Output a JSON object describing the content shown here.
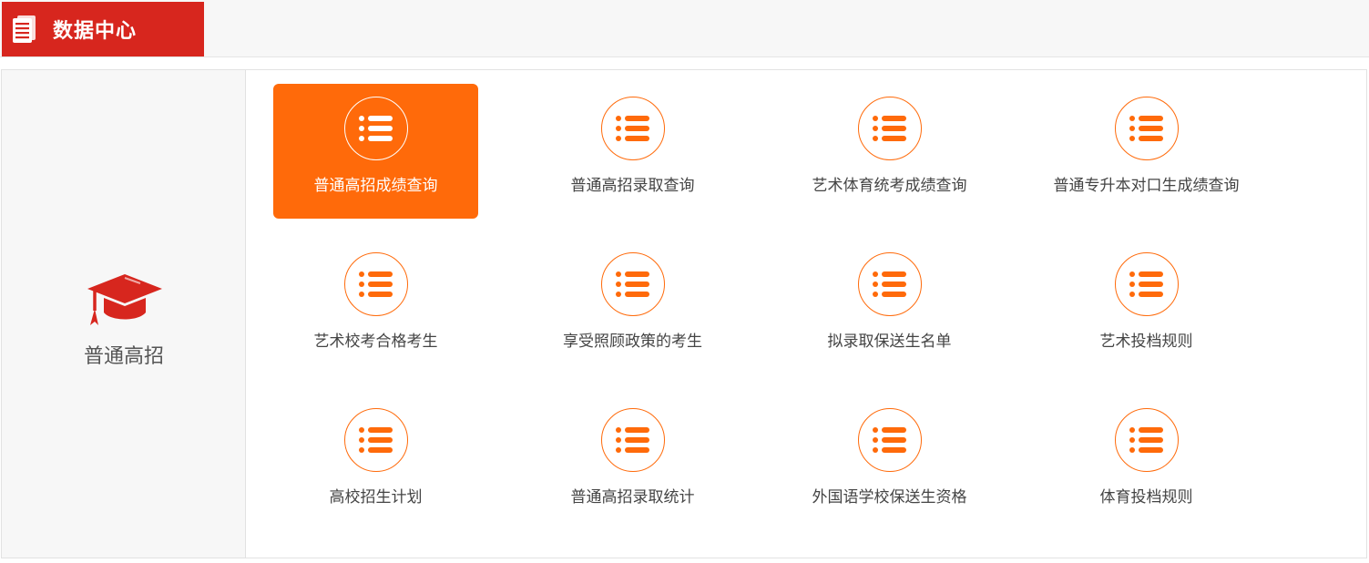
{
  "header": {
    "title": "数据中心",
    "icon": "document-icon",
    "color": "#d7261e"
  },
  "sidebar": {
    "label": "普通高招",
    "icon": "graduation-cap-icon",
    "icon_color": "#d7261e"
  },
  "accent_color": "#ff6a0a",
  "items": [
    {
      "label": "普通高招成绩查询",
      "icon": "list-icon",
      "active": true
    },
    {
      "label": "普通高招录取查询",
      "icon": "list-icon"
    },
    {
      "label": "艺术体育统考成绩查询",
      "icon": "list-icon"
    },
    {
      "label": "普通专升本对口生成绩查询",
      "icon": "list-icon"
    },
    {
      "label": "艺术校考合格考生",
      "icon": "list-icon"
    },
    {
      "label": "享受照顾政策的考生",
      "icon": "list-icon"
    },
    {
      "label": "拟录取保送生名单",
      "icon": "list-icon"
    },
    {
      "label": "艺术投档规则",
      "icon": "list-icon"
    },
    {
      "label": "高校招生计划",
      "icon": "list-icon"
    },
    {
      "label": "普通高招录取统计",
      "icon": "list-icon"
    },
    {
      "label": "外国语学校保送生资格",
      "icon": "list-icon"
    },
    {
      "label": "体育投档规则",
      "icon": "list-icon"
    }
  ]
}
